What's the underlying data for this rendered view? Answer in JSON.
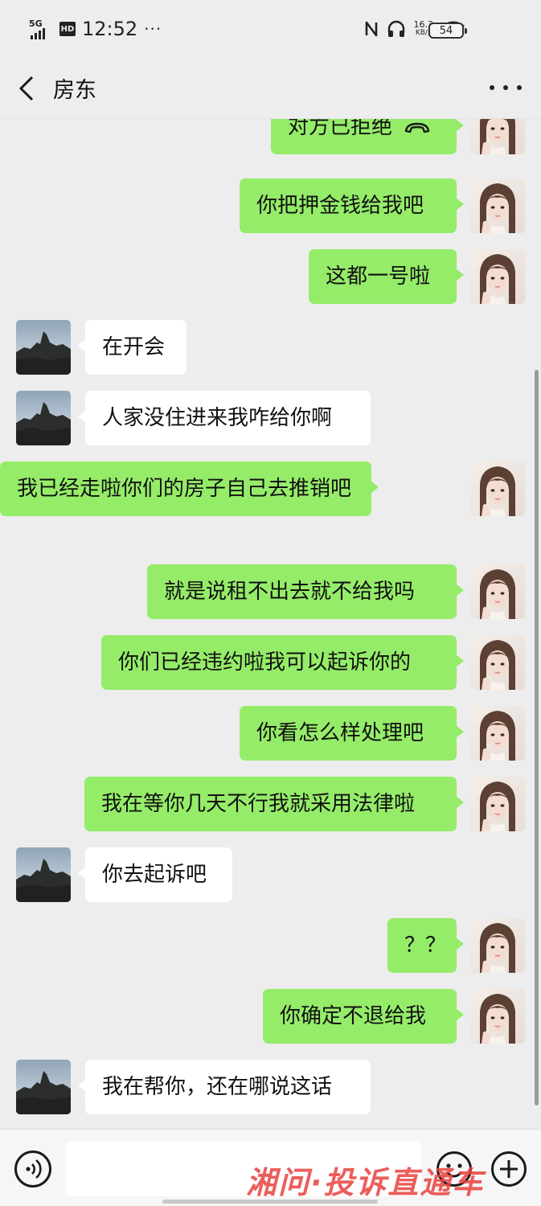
{
  "status_bar": {
    "network": "5G",
    "hd": "HD",
    "time": "12:52",
    "more": "···",
    "speed_value": "16.3",
    "speed_unit": "KB/s",
    "battery": "54"
  },
  "header": {
    "title": "房东"
  },
  "messages": [
    {
      "from": "me",
      "text": "对方已拒绝",
      "icon": "hang-up-icon"
    },
    {
      "from": "me",
      "text": "你把押金钱给我吧"
    },
    {
      "from": "me",
      "text": "这都一号啦"
    },
    {
      "from": "other",
      "text": "在开会"
    },
    {
      "from": "other",
      "text": "人家没住进来我咋给你啊"
    },
    {
      "from": "me",
      "text": "我已经走啦你们的房子自己去推销吧"
    },
    {
      "from": "me",
      "text": "就是说租不出去就不给我吗"
    },
    {
      "from": "me",
      "text": "你们已经违约啦我可以起诉你的"
    },
    {
      "from": "me",
      "text": "你看怎么样处理吧"
    },
    {
      "from": "me",
      "text": "我在等你几天不行我就采用法律啦"
    },
    {
      "from": "other",
      "text": "你去起诉吧"
    },
    {
      "from": "me",
      "text": "？？"
    },
    {
      "from": "me",
      "text": "你确定不退给我"
    },
    {
      "from": "other",
      "text": "我在帮你，还在哪说这话"
    }
  ],
  "input": {
    "placeholder": ""
  },
  "watermark": "湘问·投诉直通车",
  "colors": {
    "my_bubble": "#95ec69",
    "their_bubble": "#ffffff",
    "background": "#ededed"
  }
}
